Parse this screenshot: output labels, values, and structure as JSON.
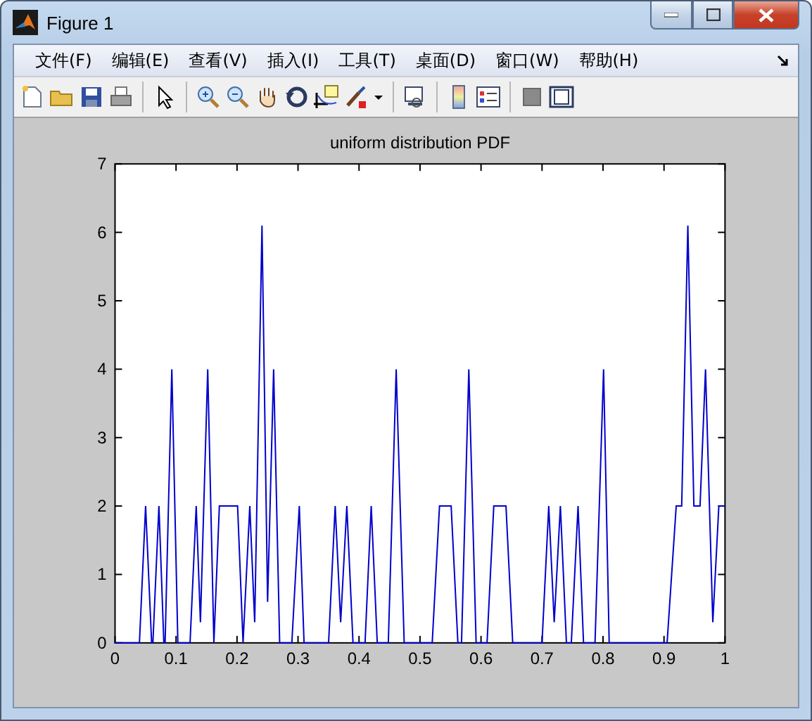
{
  "window": {
    "title": "Figure 1"
  },
  "menu": [
    "文件(F)",
    "编辑(E)",
    "查看(V)",
    "插入(I)",
    "工具(T)",
    "桌面(D)",
    "窗口(W)",
    "帮助(H)"
  ],
  "figure": {
    "chart_data": {
      "type": "line",
      "title": "uniform distribution PDF",
      "xlim": [
        0,
        1
      ],
      "ylim": [
        0,
        7
      ],
      "xticks": [
        0,
        0.1,
        0.2,
        0.3,
        0.4,
        0.5,
        0.6,
        0.7,
        0.8,
        0.9,
        1
      ],
      "yticks": [
        0,
        1,
        2,
        3,
        4,
        5,
        6,
        7
      ],
      "x": [
        0,
        0.04,
        0.05,
        0.06,
        0.062,
        0.072,
        0.08,
        0.082,
        0.093,
        0.103,
        0.123,
        0.133,
        0.14,
        0.152,
        0.162,
        0.171,
        0.201,
        0.21,
        0.221,
        0.229,
        0.241,
        0.25,
        0.26,
        0.27,
        0.29,
        0.302,
        0.31,
        0.35,
        0.361,
        0.37,
        0.38,
        0.39,
        0.41,
        0.42,
        0.43,
        0.448,
        0.461,
        0.474,
        0.52,
        0.532,
        0.551,
        0.562,
        0.568,
        0.58,
        0.592,
        0.61,
        0.621,
        0.641,
        0.652,
        0.7,
        0.711,
        0.72,
        0.73,
        0.74,
        0.748,
        0.759,
        0.768,
        0.787,
        0.801,
        0.81,
        0.905,
        0.92,
        0.929,
        0.939,
        0.949,
        0.959,
        0.968,
        0.98,
        0.99,
        1
      ],
      "series": [
        {
          "color": "#0000cc",
          "values": [
            0,
            0,
            2,
            0,
            0,
            2,
            0,
            0,
            4,
            0,
            0,
            2,
            0.3,
            4,
            0,
            2,
            2,
            0,
            2,
            0.3,
            6.1,
            0.6,
            4,
            0,
            0,
            2,
            0,
            0,
            2,
            0.3,
            2,
            0,
            0,
            2,
            0,
            0,
            4,
            0,
            0,
            2,
            2,
            0,
            0,
            4,
            0,
            0,
            2,
            2,
            0,
            0,
            2,
            0.3,
            2,
            0,
            0,
            2,
            0,
            0,
            4,
            0,
            0,
            2,
            2,
            6.1,
            2,
            2,
            4,
            0.3,
            2,
            2
          ]
        }
      ]
    }
  }
}
